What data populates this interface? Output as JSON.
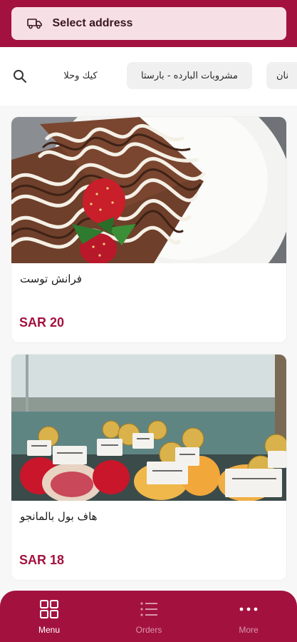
{
  "colors": {
    "brand": "#a3123f",
    "address_pill": "#f6dfe5",
    "price": "#a3123f",
    "nav_inactive": "#d995aa"
  },
  "header": {
    "address_label": "Select address",
    "icon": "delivery-truck-icon"
  },
  "categories": {
    "search_icon": "search-icon",
    "items": [
      {
        "label": "كيك وحلا"
      },
      {
        "label": "مشروبات البارده - بارستا"
      },
      {
        "label": "نان"
      }
    ]
  },
  "products": [
    {
      "name": "فرانش توست",
      "price": "SAR 20"
    },
    {
      "name": "هاف بول بالمانجو",
      "price": "SAR 18"
    }
  ],
  "bottom_nav": {
    "items": [
      {
        "label": "Menu",
        "icon": "grid-icon",
        "active": true
      },
      {
        "label": "Orders",
        "icon": "list-icon",
        "active": false
      },
      {
        "label": "More",
        "icon": "more-dots-icon",
        "active": false
      }
    ]
  }
}
